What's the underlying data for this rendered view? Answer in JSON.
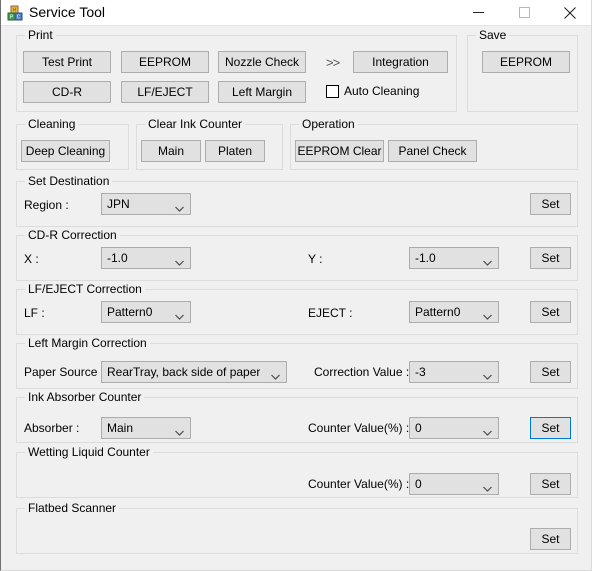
{
  "window": {
    "title": "Service Tool",
    "icon": "blocks-icon",
    "controls": {
      "minimize": "minimize-icon",
      "maximize": "maximize-icon",
      "close": "close-icon"
    }
  },
  "groups": {
    "print": {
      "legend": "Print",
      "buttons": [
        {
          "label": "Test Print"
        },
        {
          "label": "EEPROM"
        },
        {
          "label": "Nozzle Check"
        },
        {
          "label": "Integration"
        },
        {
          "label": "CD-R"
        },
        {
          "label": "LF/EJECT"
        },
        {
          "label": "Left Margin"
        }
      ],
      "chevrons": ">>",
      "checkbox": {
        "label": "Auto Cleaning",
        "checked": false
      }
    },
    "save": {
      "legend": "Save",
      "button": {
        "label": "EEPROM"
      }
    },
    "cleaning": {
      "legend": "Cleaning",
      "button": {
        "label": "Deep Cleaning"
      }
    },
    "clear_ink_counter": {
      "legend": "Clear Ink Counter",
      "buttons": [
        {
          "label": "Main"
        },
        {
          "label": "Platen"
        }
      ]
    },
    "operation": {
      "legend": "Operation",
      "buttons": [
        {
          "label": "EEPROM Clear"
        },
        {
          "label": "Panel Check"
        }
      ]
    },
    "set_destination": {
      "legend": "Set Destination",
      "region_label": "Region :",
      "region_value": "JPN",
      "set_label": "Set"
    },
    "cdr_correction": {
      "legend": "CD-R Correction",
      "x_label": "X :",
      "x_value": "-1.0",
      "y_label": "Y :",
      "y_value": "-1.0",
      "set_label": "Set"
    },
    "lf_eject_correction": {
      "legend": "LF/EJECT Correction",
      "lf_label": "LF :",
      "lf_value": "Pattern0",
      "eject_label": "EJECT :",
      "eject_value": "Pattern0",
      "set_label": "Set"
    },
    "left_margin_correction": {
      "legend": "Left Margin Correction",
      "paper_source_label": "Paper Source :",
      "paper_source_value": "RearTray, back side of paper",
      "correction_value_label": "Correction Value :",
      "correction_value": "-3",
      "set_label": "Set"
    },
    "ink_absorber_counter": {
      "legend": "Ink Absorber Counter",
      "absorber_label": "Absorber :",
      "absorber_value": "Main",
      "counter_label": "Counter Value(%) :",
      "counter_value": "0",
      "set_label": "Set"
    },
    "wetting_liquid_counter": {
      "legend": "Wetting Liquid Counter",
      "counter_label": "Counter Value(%) :",
      "counter_value": "0",
      "set_label": "Set"
    },
    "flatbed_scanner": {
      "legend": "Flatbed Scanner",
      "set_label": "Set"
    }
  },
  "colors": {
    "window_bg": "#f0f0f0",
    "button_face": "#e1e1e1",
    "button_border": "#adadad",
    "group_border": "#dcdcdc",
    "focus_blue": "#0078d7",
    "titlebar_bg": "#ffffff"
  }
}
